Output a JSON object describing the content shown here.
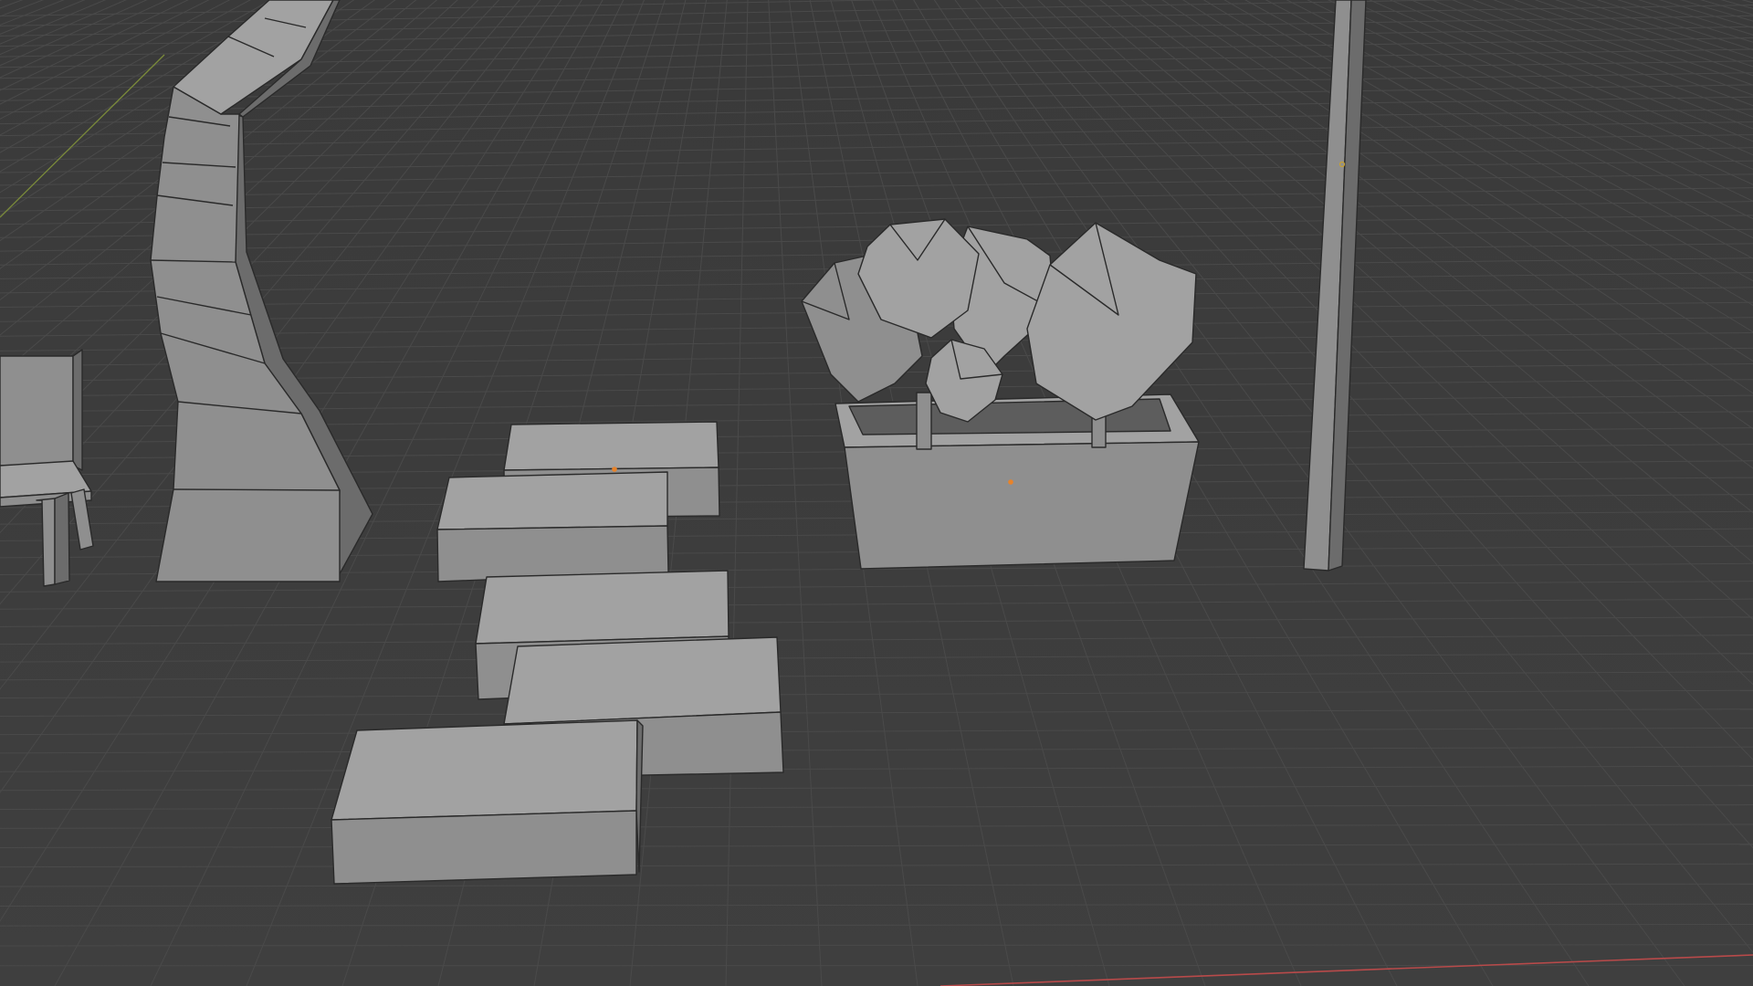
{
  "viewport": {
    "background": "#3d3d3d",
    "grid_color": "#4a4a4a",
    "x_axis_color": "#b84a4a",
    "y_axis_color": "#7a8a3a",
    "mesh_color": "#9a9a9a",
    "origin_color": "#e8832a"
  },
  "scene_objects": [
    "bench",
    "curved-pillar",
    "stepping-stone",
    "planter-box",
    "tree-foliage",
    "lamp-post"
  ]
}
